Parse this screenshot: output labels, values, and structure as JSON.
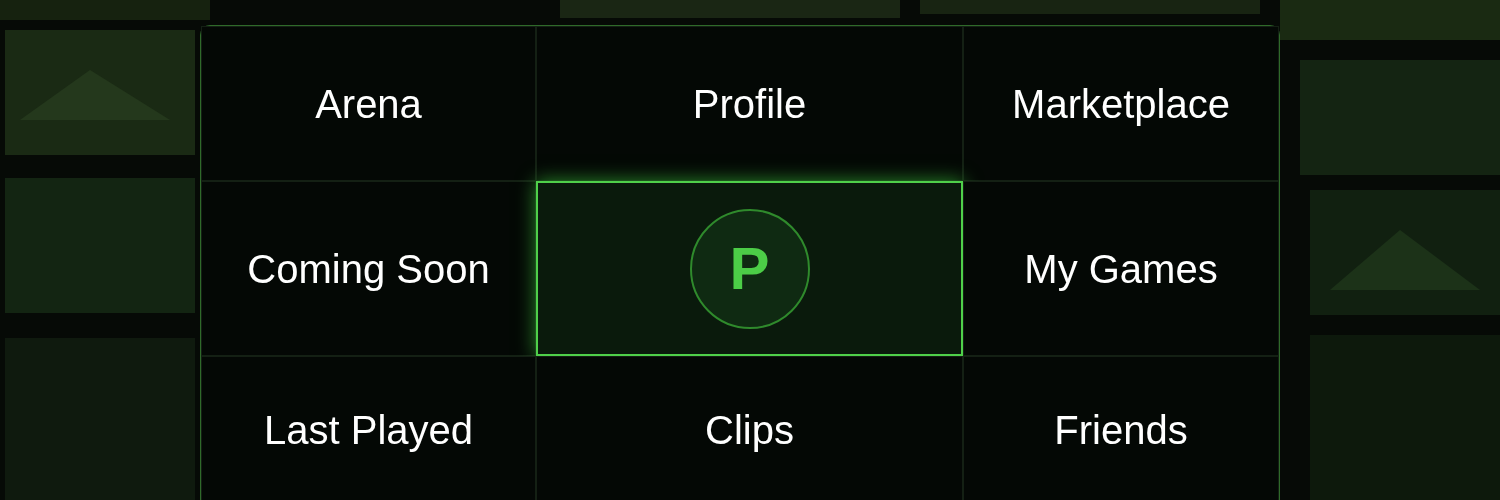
{
  "menu": {
    "tiles": [
      {
        "kind": "label",
        "label": "Arena",
        "selected": false
      },
      {
        "kind": "label",
        "label": "Profile",
        "selected": false
      },
      {
        "kind": "label",
        "label": "Marketplace",
        "selected": false
      },
      {
        "kind": "label",
        "label": "Coming Soon",
        "selected": false
      },
      {
        "kind": "logo",
        "label": "P",
        "selected": true
      },
      {
        "kind": "label",
        "label": "My Games",
        "selected": false
      },
      {
        "kind": "label",
        "label": "Last Played",
        "selected": false
      },
      {
        "kind": "label",
        "label": "Clips",
        "selected": false
      },
      {
        "kind": "label",
        "label": "Friends",
        "selected": false
      }
    ]
  }
}
